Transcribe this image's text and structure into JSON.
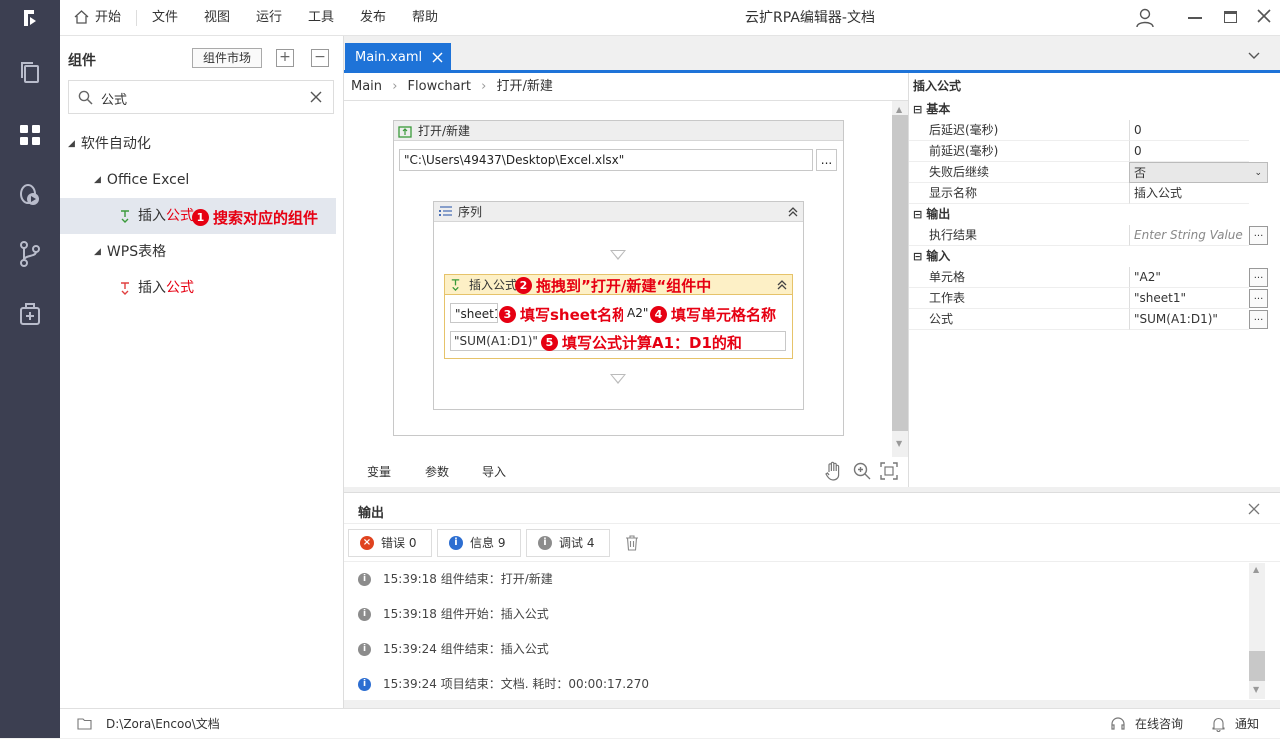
{
  "menu": {
    "home": "开始",
    "file": "文件",
    "view": "视图",
    "run": "运行",
    "tools": "工具",
    "publish": "发布",
    "help": "帮助"
  },
  "window_title": "云扩RPA编辑器-文档",
  "left_panel": {
    "title": "组件",
    "market_button": "组件市场",
    "search_value": "公式",
    "tree": {
      "software_automation": "软件自动化",
      "office_excel": "Office Excel",
      "insert_prefix": "插入",
      "insert_highlight": "公式",
      "wps": "WPS表格"
    },
    "annotation1": "搜索对应的组件"
  },
  "tab": {
    "label": "Main.xaml"
  },
  "breadcrumb": {
    "main": "Main",
    "flowchart": "Flowchart",
    "current": "打开/新建"
  },
  "canvas": {
    "open_new_title": "打开/新建",
    "path_value": "\"C:\\Users\\49437\\Desktop\\Excel.xlsx\"",
    "browse": "...",
    "sequence_title": "序列",
    "insert_formula_title": "插入公式",
    "sheet_value": "\"sheet1\"",
    "cell_value": "A2\"",
    "formula_value": "\"SUM(A1:D1)\"",
    "annotation2": "拖拽到”打开/新建“组件中",
    "annotation3": "填写sheet名称",
    "annotation4": "填写单元格名称",
    "annotation5": "填写公式计算A1：D1的和"
  },
  "editor_footer": {
    "variables": "变量",
    "arguments": "参数",
    "imports": "导入"
  },
  "properties": {
    "title": "插入公式",
    "basic": "基本",
    "delay_after_label": "后延迟(毫秒)",
    "delay_after_value": "0",
    "delay_before_label": "前延迟(毫秒)",
    "delay_before_value": "0",
    "continue_label": "失败后继续",
    "continue_value": "否",
    "display_label": "显示名称",
    "display_value": "插入公式",
    "output": "输出",
    "result_label": "执行结果",
    "result_placeholder": "Enter String Value",
    "input": "输入",
    "cell_label": "单元格",
    "cell_value": "\"A2\"",
    "sheet_label": "工作表",
    "sheet_value": "\"sheet1\"",
    "formula_label": "公式",
    "formula_value": "\"SUM(A1:D1)\"",
    "btn": "..."
  },
  "output": {
    "title": "输出",
    "error_label": "错误",
    "error_count": "0",
    "info_label": "信息",
    "info_count": "9",
    "debug_label": "调试",
    "debug_count": "4",
    "logs": [
      {
        "time": "15:39:18",
        "text": "组件结束：打开/新建"
      },
      {
        "time": "15:39:18",
        "text": "组件开始：插入公式"
      },
      {
        "time": "15:39:24",
        "text": "组件结束：插入公式"
      },
      {
        "time": "15:39:24",
        "text": "项目结束：文档. 耗时：00:00:17.270"
      }
    ]
  },
  "status": {
    "path": "D:\\Zora\\Encoo\\文档",
    "consult": "在线咨询",
    "notify": "通知"
  },
  "colors": {
    "accent": "#1e73d8",
    "rail": "#3c3f51",
    "annotation": "#e60012",
    "highlight_row": "#e3e7ee",
    "activity_header": "#fdf0c6"
  }
}
